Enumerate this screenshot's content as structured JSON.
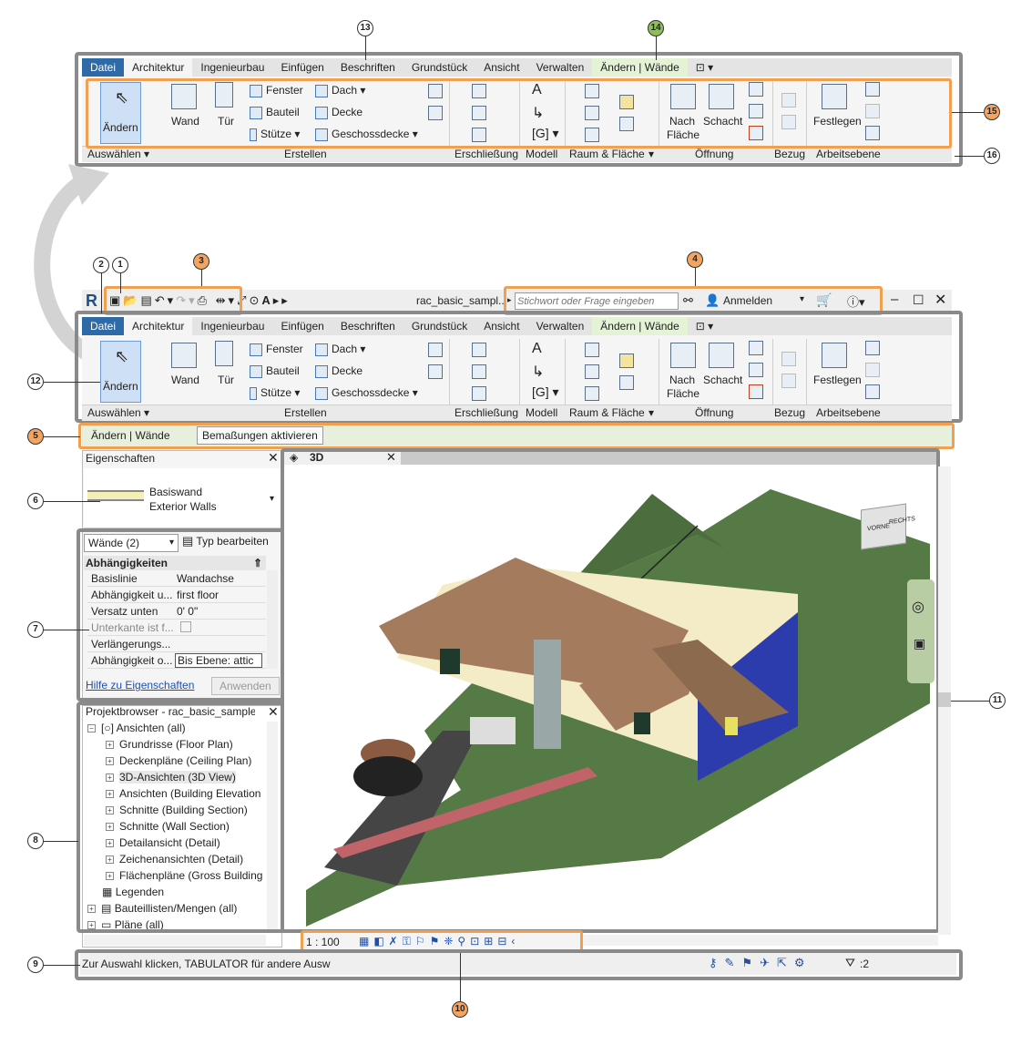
{
  "tabs": [
    "Datei",
    "Architektur",
    "Ingenieurbau",
    "Einfügen",
    "Beschriften",
    "Grundstück",
    "Ansicht",
    "Verwalten",
    "Ändern | Wände"
  ],
  "ribbon": {
    "aendern": "Ändern",
    "wand": "Wand",
    "tuer": "Tür",
    "fenster": "Fenster",
    "bauteil": "Bauteil",
    "stuetze": "Stütze",
    "dach": "Dach",
    "decke": "Decke",
    "geschossdecke": "Geschossdecke",
    "nach": "Nach",
    "flaeche": "Fläche",
    "schacht": "Schacht",
    "festlegen": "Festlegen",
    "panels": [
      "Auswählen",
      "Erstellen",
      "Erschließung",
      "Modell",
      "Raum & Fläche",
      "Öffnung",
      "Bezug",
      "Arbeitsebene"
    ]
  },
  "title_bar": {
    "doc_title": "rac_basic_sampl...",
    "search_placeholder": "Stichwort oder Frage eingeben",
    "login": "Anmelden"
  },
  "context_bar": {
    "mode": "Ändern | Wände",
    "dims_button": "Bemaßungen aktivieren"
  },
  "properties": {
    "title": "Eigenschaften",
    "type_line1": "Basiswand",
    "type_line2": "Exterior Walls",
    "filter": "Wände (2)",
    "edit_type": "Typ bearbeiten",
    "group": "Abhängigkeiten",
    "rows": [
      {
        "name": "Basislinie",
        "value": "Wandachse"
      },
      {
        "name": "Abhängigkeit u...",
        "value": "first floor"
      },
      {
        "name": "Versatz unten",
        "value": "0'  0\""
      },
      {
        "name": "Unterkante ist f...",
        "value": ""
      },
      {
        "name": "Verlängerungs...",
        "value": ""
      },
      {
        "name": "Abhängigkeit o...",
        "value": "Bis Ebene: attic"
      }
    ],
    "help_link": "Hilfe zu Eigenschaften",
    "apply": "Anwenden"
  },
  "browser": {
    "title": "Projektbrowser - rac_basic_sample_...",
    "root": "Ansichten (all)",
    "items": [
      "Grundrisse (Floor Plan)",
      "Deckenpläne (Ceiling Plan)",
      "3D-Ansichten (3D View)",
      "Ansichten (Building Elevation",
      "Schnitte (Building Section)",
      "Schnitte (Wall Section)",
      "Detailansicht (Detail)",
      "Zeichenansichten (Detail)",
      "Flächenpläne (Gross Building"
    ],
    "legends": "Legenden",
    "schedules": "Bauteillisten/Mengen (all)",
    "sheets": "Pläne (all)"
  },
  "view": {
    "tab": "3D",
    "scale": "1 : 100",
    "viewcube_front": "VORNE",
    "viewcube_right": "RECHTS"
  },
  "status": {
    "text": "Zur Auswahl klicken, TABULATOR für andere Ausw",
    "filter_count": ":2"
  },
  "callouts": [
    "1",
    "2",
    "3",
    "4",
    "5",
    "6",
    "7",
    "8",
    "9",
    "10",
    "11",
    "12",
    "13",
    "14",
    "15",
    "16"
  ]
}
